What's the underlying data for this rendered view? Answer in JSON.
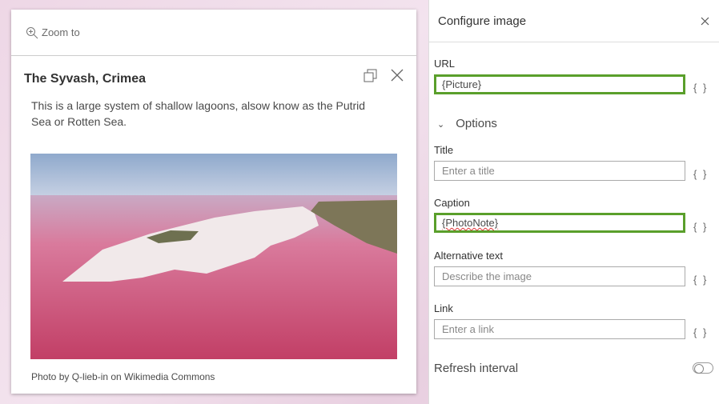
{
  "popup": {
    "zoom_label": "Zoom to",
    "title": "The Syvash, Crimea",
    "description": "This is a large system of shallow lagoons, alsow know as the Putrid Sea or Rotten Sea.",
    "caption": "Photo by Q-lieb-in on Wikimedia Commons"
  },
  "panel": {
    "title": "Configure image",
    "url_label": "URL",
    "url_value": "{Picture}",
    "options_label": "Options",
    "title_label": "Title",
    "title_placeholder": "Enter a title",
    "caption_label": "Caption",
    "caption_value": "{PhotoNote}",
    "alt_label": "Alternative text",
    "alt_placeholder": "Describe the image",
    "link_label": "Link",
    "link_placeholder": "Enter a link",
    "refresh_label": "Refresh interval",
    "refresh_enabled": false,
    "expr_icon": "{ }"
  },
  "colors": {
    "active_border": "#5a9f2b"
  }
}
